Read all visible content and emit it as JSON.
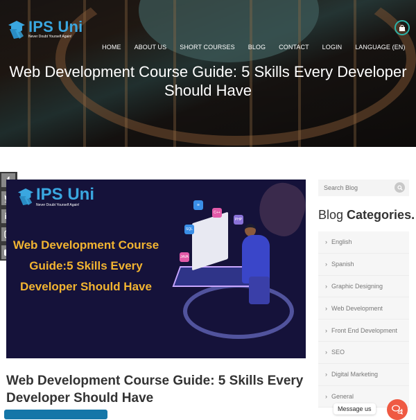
{
  "header": {
    "logo": {
      "title": "IPS Uni",
      "tagline": "Never Doubt Yourself Again!"
    },
    "nav": [
      {
        "label": "HOME"
      },
      {
        "label": "ABOUT US"
      },
      {
        "label": "SHORT COURSES"
      },
      {
        "label": "BLOG"
      },
      {
        "label": "CONTACT"
      },
      {
        "label": "LOGIN"
      },
      {
        "label": "LANGUAGE (EN)"
      }
    ],
    "cart_icon": "shopping-bag-icon",
    "page_title": "Web Development Course Guide: 5 Skills Every Developer Should Have"
  },
  "social": [
    {
      "icon": "facebook-icon",
      "glyph": "f"
    },
    {
      "icon": "twitter-icon",
      "glyph": "t"
    },
    {
      "icon": "linkedin-icon",
      "glyph": "in"
    },
    {
      "icon": "instagram-icon",
      "glyph": "◎"
    },
    {
      "icon": "youtube-icon",
      "glyph": "▶"
    }
  ],
  "feature_image": {
    "logo_title": "IPS Uni",
    "logo_tagline": "Never Doubt Yourself Again!",
    "title": "Web Development Course Guide:5 Skills Every Developer Should Have",
    "chips": [
      "SQL",
      "C++",
      "PHP",
      "JAVA"
    ]
  },
  "post": {
    "title": "Web Development Course Guide: 5 Skills Every Developer Should Have"
  },
  "sidebar": {
    "search_placeholder": "Search Blog",
    "categories_heading_light": "Blog",
    "categories_heading_bold": "Categories.",
    "categories": [
      "English",
      "Spanish",
      "Graphic Designing",
      "Web Development",
      "Front End Development",
      "SEO",
      "Digital Marketing",
      "General"
    ]
  },
  "chat": {
    "tooltip": "Message us"
  },
  "colors": {
    "brand_blue": "#3aa7e0",
    "feature_title": "#f2b431",
    "button_blue": "#1476a8",
    "chat_red": "#ef5a43",
    "cart_teal": "#2bb3a8"
  }
}
